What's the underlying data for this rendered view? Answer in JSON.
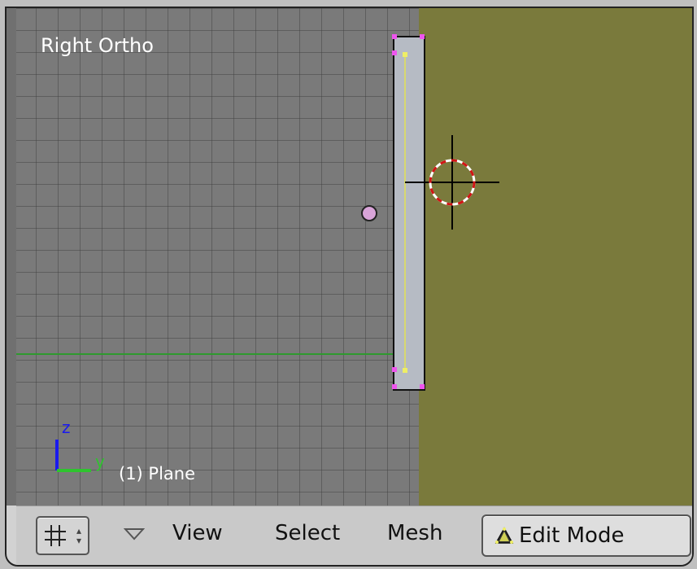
{
  "viewport": {
    "view_label": "Right Ortho",
    "object_label": "(1) Plane",
    "axis_labels": {
      "z": "z",
      "y": "y"
    },
    "colors": {
      "grid_bg": "#7a7a7a",
      "olive_bg": "#7a7a3c",
      "y_axis": "#2e9a2e"
    }
  },
  "header": {
    "editor_type_icon": "grid-icon",
    "menus": [
      "View",
      "Select",
      "Mesh"
    ],
    "mode": {
      "icon": "edit-mode-icon",
      "label": "Edit Mode"
    }
  }
}
